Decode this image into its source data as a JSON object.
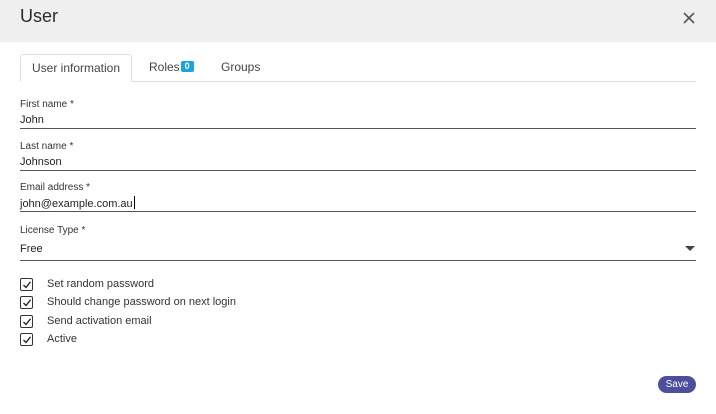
{
  "dialog": {
    "title": "User"
  },
  "tabs": [
    {
      "label": "User information",
      "active": true
    },
    {
      "label": "Roles",
      "badge": "0"
    },
    {
      "label": "Groups"
    }
  ],
  "form": {
    "first_name": {
      "label": "First name *",
      "value": "John"
    },
    "last_name": {
      "label": "Last name *",
      "value": "Johnson"
    },
    "email": {
      "label": "Email address *",
      "value": "john@example.com.au"
    },
    "license_type": {
      "label": "License Type *",
      "value": "Free"
    }
  },
  "checkboxes": [
    {
      "label": "Set random password",
      "checked": true
    },
    {
      "label": "Should change password on next login",
      "checked": true
    },
    {
      "label": "Send activation email",
      "checked": true
    },
    {
      "label": "Active",
      "checked": true
    }
  ],
  "actions": {
    "save_label": "Save"
  },
  "colors": {
    "header_bg": "#efefef",
    "accent": "#4d4f9e",
    "badge": "#1aa4d9"
  },
  "icons": {
    "close": "close-icon",
    "dropdown": "chevron-down-icon",
    "check": "check-icon"
  }
}
